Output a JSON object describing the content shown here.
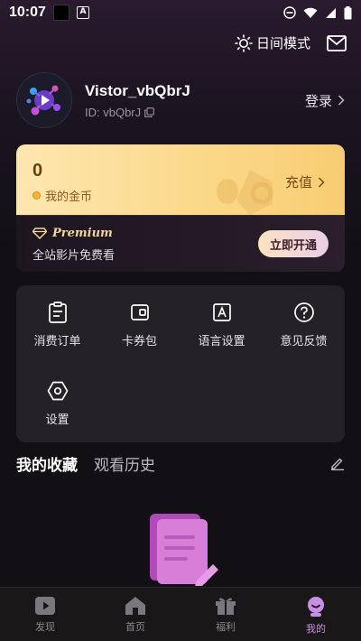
{
  "status_bar": {
    "time": "10:07"
  },
  "header": {
    "day_mode_label": "日间模式"
  },
  "profile": {
    "username": "Vistor_vbQbrJ",
    "user_id": "ID: vbQbrJ",
    "login_label": "登录"
  },
  "coin_card": {
    "coin_count": "0",
    "coin_label": "我的金币",
    "recharge_label": "充值",
    "premium_title": "Premium",
    "premium_subtitle": "全站影片免费看",
    "open_button": "立即开通"
  },
  "menu": {
    "items": [
      {
        "label": "消费订单",
        "icon": "clipboard-icon"
      },
      {
        "label": "卡券包",
        "icon": "wallet-icon"
      },
      {
        "label": "语言设置",
        "icon": "language-icon"
      },
      {
        "label": "意见反馈",
        "icon": "help-icon"
      },
      {
        "label": "设置",
        "icon": "settings-icon"
      }
    ]
  },
  "tabs": {
    "favorites": "我的收藏",
    "history": "观看历史"
  },
  "bottom_nav": {
    "items": [
      {
        "label": "发现",
        "icon": "play-square-icon"
      },
      {
        "label": "首页",
        "icon": "home-icon"
      },
      {
        "label": "福利",
        "icon": "gift-icon"
      },
      {
        "label": "我的",
        "icon": "profile-icon",
        "active": true
      }
    ]
  },
  "colors": {
    "accent": "#c98ee8",
    "gold": "#fbd98a",
    "background": "#121014"
  }
}
